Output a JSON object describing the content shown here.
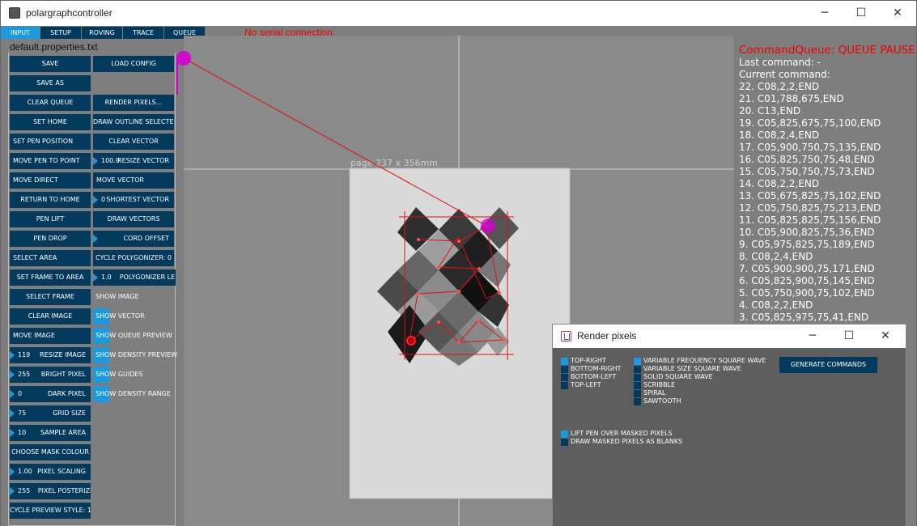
{
  "window": {
    "title": "polargraphcontroller",
    "minimize": "─",
    "maximize": "☐",
    "close": "✕"
  },
  "tabs": [
    "INPUT",
    "SETUP",
    "ROVING",
    "TRACE",
    "QUEUE"
  ],
  "status": {
    "serial": "No serial connection."
  },
  "properties_file": "default.properties.txt",
  "buttons": {
    "save": "SAVE",
    "load_config": "LOAD CONFIG",
    "save_as": "SAVE AS",
    "clear_queue": "CLEAR QUEUE",
    "render_pixels": "RENDER PIXELS...",
    "set_home": "SET HOME",
    "draw_outline_selected": "DRAW OUTLINE SELECTED",
    "set_pen_position": "SET PEN POSITION",
    "clear_vector": "CLEAR VECTOR",
    "move_pen_to_point": "MOVE PEN TO POINT",
    "move_direct": "MOVE DIRECT",
    "move_vector": "MOVE VECTOR",
    "return_to_home": "RETURN TO HOME",
    "pen_lift": "PEN LIFT",
    "draw_vectors": "DRAW VECTORS",
    "pen_drop": "PEN DROP",
    "select_area": "SELECT AREA",
    "cycle_polygonizer": "CYCLE POLYGONIZER: 0",
    "set_frame_to_area": "SET FRAME TO AREA",
    "select_frame": "SELECT FRAME",
    "clear_image": "CLEAR IMAGE",
    "move_image": "MOVE IMAGE",
    "choose_mask_colour": "CHOOSE MASK COLOUR",
    "cycle_preview_style": "CYCLE PREVIEW STYLE: 1"
  },
  "numbers": {
    "resize_vector": {
      "value": "100.0",
      "label": "RESIZE VECTOR"
    },
    "shortest_vector": {
      "value": "0",
      "label": "SHORTEST VECTOR"
    },
    "cord_offset": {
      "value": "",
      "label": "CORD OFFSET"
    },
    "polygonizer_length": {
      "value": "1.0",
      "label": "POLYGONIZER LENGTH"
    },
    "resize_image": {
      "value": "119",
      "label": "RESIZE IMAGE"
    },
    "bright_pixel": {
      "value": "255",
      "label": "BRIGHT PIXEL"
    },
    "dark_pixel": {
      "value": "0",
      "label": "DARK PIXEL"
    },
    "grid_size": {
      "value": "75",
      "label": "GRID SIZE"
    },
    "sample_area": {
      "value": "10",
      "label": "SAMPLE AREA"
    },
    "pixel_scaling": {
      "value": "1.00",
      "label": "PIXEL SCALING"
    },
    "pixel_posterize": {
      "value": "255",
      "label": "PIXEL POSTERIZE"
    }
  },
  "toggles": {
    "show_image": {
      "label": "SHOW IMAGE",
      "on": false
    },
    "show_vector": {
      "label": "SHOW VECTOR",
      "on": true
    },
    "show_queue_preview": {
      "label": "SHOW QUEUE PREVIEW",
      "on": true
    },
    "show_density_preview": {
      "label": "SHOW DENSITY PREVIEW",
      "on": true
    },
    "show_guides": {
      "label": "SHOW GUIDES",
      "on": true
    },
    "show_density_range": {
      "label": "SHOW DENSITY RANGE",
      "on": true
    }
  },
  "page": {
    "label": "page 237 x 356mm"
  },
  "queue": {
    "header": "CommandQueue: QUEUE PAUSED",
    "last_command": "Last command: -",
    "current_command": "Current command:",
    "items": [
      "22. C08,2,2,END",
      "21. C01,788,675,END",
      "20. C13,END",
      "19. C05,825,675,75,100,END",
      "18. C08,2,4,END",
      "17. C05,900,750,75,135,END",
      "16. C05,825,750,75,48,END",
      "15. C05,750,750,75,73,END",
      "14. C08,2,2,END",
      "13. C05,675,825,75,102,END",
      "12. C05,750,825,75,213,END",
      "11. C05,825,825,75,156,END",
      "10. C05,900,825,75,36,END",
      "9. C05,975,825,75,189,END",
      "8. C08,2,4,END",
      "7. C05,900,900,75,171,END",
      "6. C05,825,900,75,145,END",
      "5. C05,750,900,75,102,END",
      "4. C08,2,2,END",
      "3. C05,825,975,75,41,END"
    ]
  },
  "render_dialog": {
    "title": "Render pixels",
    "minimize": "─",
    "maximize": "☐",
    "close": "✕",
    "start_corner": [
      {
        "label": "TOP-RIGHT",
        "on": true
      },
      {
        "label": "BOTTOM-RIGHT",
        "on": false
      },
      {
        "label": "BOTTOM-LEFT",
        "on": false
      },
      {
        "label": "TOP-LEFT",
        "on": false
      }
    ],
    "styles": [
      {
        "label": "VARIABLE FREQUENCY SQUARE WAVE",
        "on": true
      },
      {
        "label": "VARIABLE SIZE SQUARE WAVE",
        "on": false
      },
      {
        "label": "SOLID SQUARE WAVE",
        "on": false
      },
      {
        "label": "SCRIBBLE",
        "on": false
      },
      {
        "label": "SPIRAL",
        "on": false
      },
      {
        "label": "SAWTOOTH",
        "on": false
      }
    ],
    "mask_options": [
      {
        "label": "LIFT PEN OVER MASKED PIXELS",
        "on": true
      },
      {
        "label": "DRAW MASKED PIXELS AS BLANKS",
        "on": false
      }
    ],
    "generate": "GENERATE COMMANDS"
  },
  "colors": {
    "button": "#013a5c",
    "accent": "#1a9be0",
    "error": "#e00000",
    "pen_marker": "#d400d4"
  }
}
